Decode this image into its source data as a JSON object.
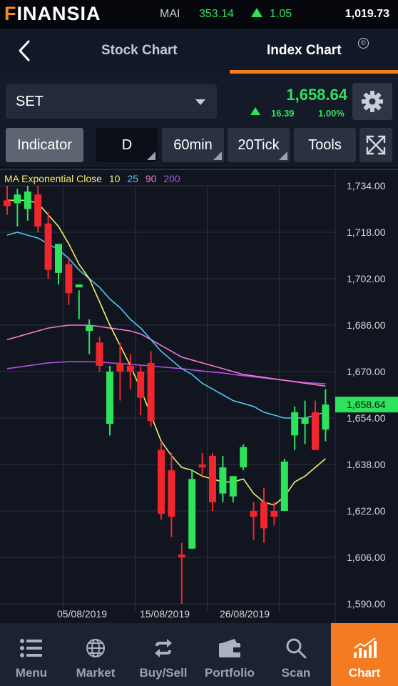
{
  "status_bar": {
    "brand": "FINANSIA",
    "market_name": "MAI",
    "market_value": "353.14",
    "market_change": "1.05",
    "market_volume": "1,019.73"
  },
  "nav": {
    "back_icon": "chevron-left-icon",
    "tabs": [
      {
        "label": "Stock Chart",
        "active": false
      },
      {
        "label": "Index Chart",
        "active": true
      }
    ]
  },
  "symbol_bar": {
    "symbol": "SET",
    "last_price": "1,658.64",
    "change": "16.39",
    "change_percent": "1.00%",
    "settings_icon": "gear-icon"
  },
  "toolbar": {
    "indicator_label": "Indicator",
    "periods": [
      "D",
      "60min",
      "20Tick"
    ],
    "selected_period": "D",
    "tools_label": "Tools",
    "fullscreen_icon": "fullscreen-icon"
  },
  "chart_legend": {
    "name": "MA Exponential Close",
    "periods": [
      "10",
      "25",
      "90",
      "200"
    ],
    "colors": [
      "#f5ec6e",
      "#54c5f2",
      "#f07ad0",
      "#b44fe0"
    ]
  },
  "colors": {
    "up": "#2ee35c",
    "down": "#f0262c",
    "accent": "#f47b20"
  },
  "chart_data": {
    "type": "candlestick",
    "y_ticks": [
      "1,734.00",
      "1,718.00",
      "1,702.00",
      "1,686.00",
      "1,670.00",
      "1,654.00",
      "1,638.00",
      "1,622.00",
      "1,606.00",
      "1,590.00"
    ],
    "ylim": [
      1587,
      1739
    ],
    "x_tick_labels": [
      "05/08/2019",
      "15/08/2019",
      "26/08/2019"
    ],
    "last_price_label": "1,658.64",
    "last_price": 1658.64,
    "candles": [
      {
        "o": 1729,
        "h": 1734,
        "l": 1724,
        "c": 1727
      },
      {
        "o": 1728,
        "h": 1733,
        "l": 1720,
        "c": 1731
      },
      {
        "o": 1726,
        "h": 1734,
        "l": 1722,
        "c": 1732
      },
      {
        "o": 1731,
        "h": 1734,
        "l": 1718,
        "c": 1720
      },
      {
        "o": 1721,
        "h": 1725,
        "l": 1702,
        "c": 1705
      },
      {
        "o": 1704,
        "h": 1713,
        "l": 1700,
        "c": 1714
      },
      {
        "o": 1707,
        "h": 1709,
        "l": 1693,
        "c": 1697
      },
      {
        "o": 1699,
        "h": 1698,
        "l": 1688,
        "c": 1700
      },
      {
        "o": 1684,
        "h": 1688,
        "l": 1676,
        "c": 1686
      },
      {
        "o": 1680,
        "h": 1682,
        "l": 1670,
        "c": 1672
      },
      {
        "o": 1652,
        "h": 1672,
        "l": 1648,
        "c": 1670
      },
      {
        "o": 1673,
        "h": 1680,
        "l": 1660,
        "c": 1670
      },
      {
        "o": 1672,
        "h": 1676,
        "l": 1664,
        "c": 1670
      },
      {
        "o": 1670,
        "h": 1672,
        "l": 1655,
        "c": 1661
      },
      {
        "o": 1673,
        "h": 1677,
        "l": 1651,
        "c": 1653
      },
      {
        "o": 1643,
        "h": 1646,
        "l": 1619,
        "c": 1621
      },
      {
        "o": 1636,
        "h": 1642,
        "l": 1613,
        "c": 1620
      },
      {
        "o": 1607,
        "h": 1611,
        "l": 1590,
        "c": 1606
      },
      {
        "o": 1609,
        "h": 1636,
        "l": 1609,
        "c": 1633
      },
      {
        "o": 1638,
        "h": 1642,
        "l": 1634,
        "c": 1637
      },
      {
        "o": 1641,
        "h": 1642,
        "l": 1622,
        "c": 1625
      },
      {
        "o": 1628,
        "h": 1641,
        "l": 1625,
        "c": 1637
      },
      {
        "o": 1627,
        "h": 1633,
        "l": 1625,
        "c": 1634
      },
      {
        "o": 1637,
        "h": 1645,
        "l": 1636,
        "c": 1644
      },
      {
        "o": 1622,
        "h": 1625,
        "l": 1612,
        "c": 1620
      },
      {
        "o": 1625,
        "h": 1630,
        "l": 1611,
        "c": 1616
      },
      {
        "o": 1622,
        "h": 1625,
        "l": 1617,
        "c": 1620
      },
      {
        "o": 1622,
        "h": 1640,
        "l": 1622,
        "c": 1639
      },
      {
        "o": 1648,
        "h": 1658,
        "l": 1643,
        "c": 1656
      },
      {
        "o": 1652,
        "h": 1660,
        "l": 1645,
        "c": 1654
      },
      {
        "o": 1656,
        "h": 1660,
        "l": 1643,
        "c": 1643
      },
      {
        "o": 1650,
        "h": 1664,
        "l": 1646,
        "c": 1658.64
      }
    ],
    "candle_dates_ticks": {
      "05/08/2019": 7,
      "15/08/2019": 15,
      "26/08/2019": 23
    },
    "series": [
      {
        "period": "10",
        "color": "#f5ec6e",
        "values": [
          1729,
          1729,
          1729,
          1728,
          1724,
          1720,
          1714,
          1707,
          1702,
          1694,
          1686,
          1679,
          1672,
          1664,
          1655,
          1646,
          1641,
          1637,
          1636,
          1634,
          1633,
          1632,
          1632,
          1633,
          1628,
          1625,
          1624,
          1627,
          1632,
          1634,
          1637,
          1640
        ]
      },
      {
        "period": "25",
        "color": "#54c5f2",
        "values": [
          1717,
          1718,
          1717,
          1716,
          1714,
          1712,
          1709,
          1705,
          1702,
          1699,
          1695,
          1692,
          1688,
          1685,
          1681,
          1677,
          1674,
          1671,
          1669,
          1666,
          1664,
          1662,
          1660,
          1659,
          1658,
          1656,
          1655,
          1654,
          1654,
          1654,
          1655,
          1656
        ]
      },
      {
        "period": "90",
        "color": "#f07ad0",
        "values": [
          1681,
          1682,
          1683,
          1684,
          1685,
          1685.5,
          1686,
          1686,
          1686,
          1685.5,
          1685,
          1684.5,
          1684,
          1683,
          1681,
          1679,
          1677,
          1675,
          1674,
          1673,
          1672,
          1671,
          1670,
          1669,
          1668.5,
          1668,
          1667.5,
          1667,
          1666.5,
          1666,
          1665.5,
          1665
        ]
      },
      {
        "period": "200",
        "color": "#b44fe0",
        "values": [
          1671,
          1671.5,
          1672,
          1672.5,
          1673,
          1673.2,
          1673.4,
          1673.4,
          1673.4,
          1673.3,
          1673,
          1672.8,
          1672.5,
          1672.2,
          1672,
          1671.6,
          1671.3,
          1671,
          1670.6,
          1670.2,
          1669.8,
          1669.5,
          1669,
          1668.6,
          1668.2,
          1667.8,
          1667.4,
          1667,
          1666.6,
          1666.2,
          1666,
          1665.8
        ]
      }
    ]
  },
  "bottom_nav": [
    {
      "label": "Menu",
      "icon": "menu-icon",
      "active": false
    },
    {
      "label": "Market",
      "icon": "globe-icon",
      "active": false
    },
    {
      "label": "Buy/Sell",
      "icon": "swap-icon",
      "active": false
    },
    {
      "label": "Portfolio",
      "icon": "wallet-icon",
      "active": false
    },
    {
      "label": "Scan",
      "icon": "search-icon",
      "active": false
    },
    {
      "label": "Chart",
      "icon": "chart-icon",
      "active": true
    }
  ]
}
